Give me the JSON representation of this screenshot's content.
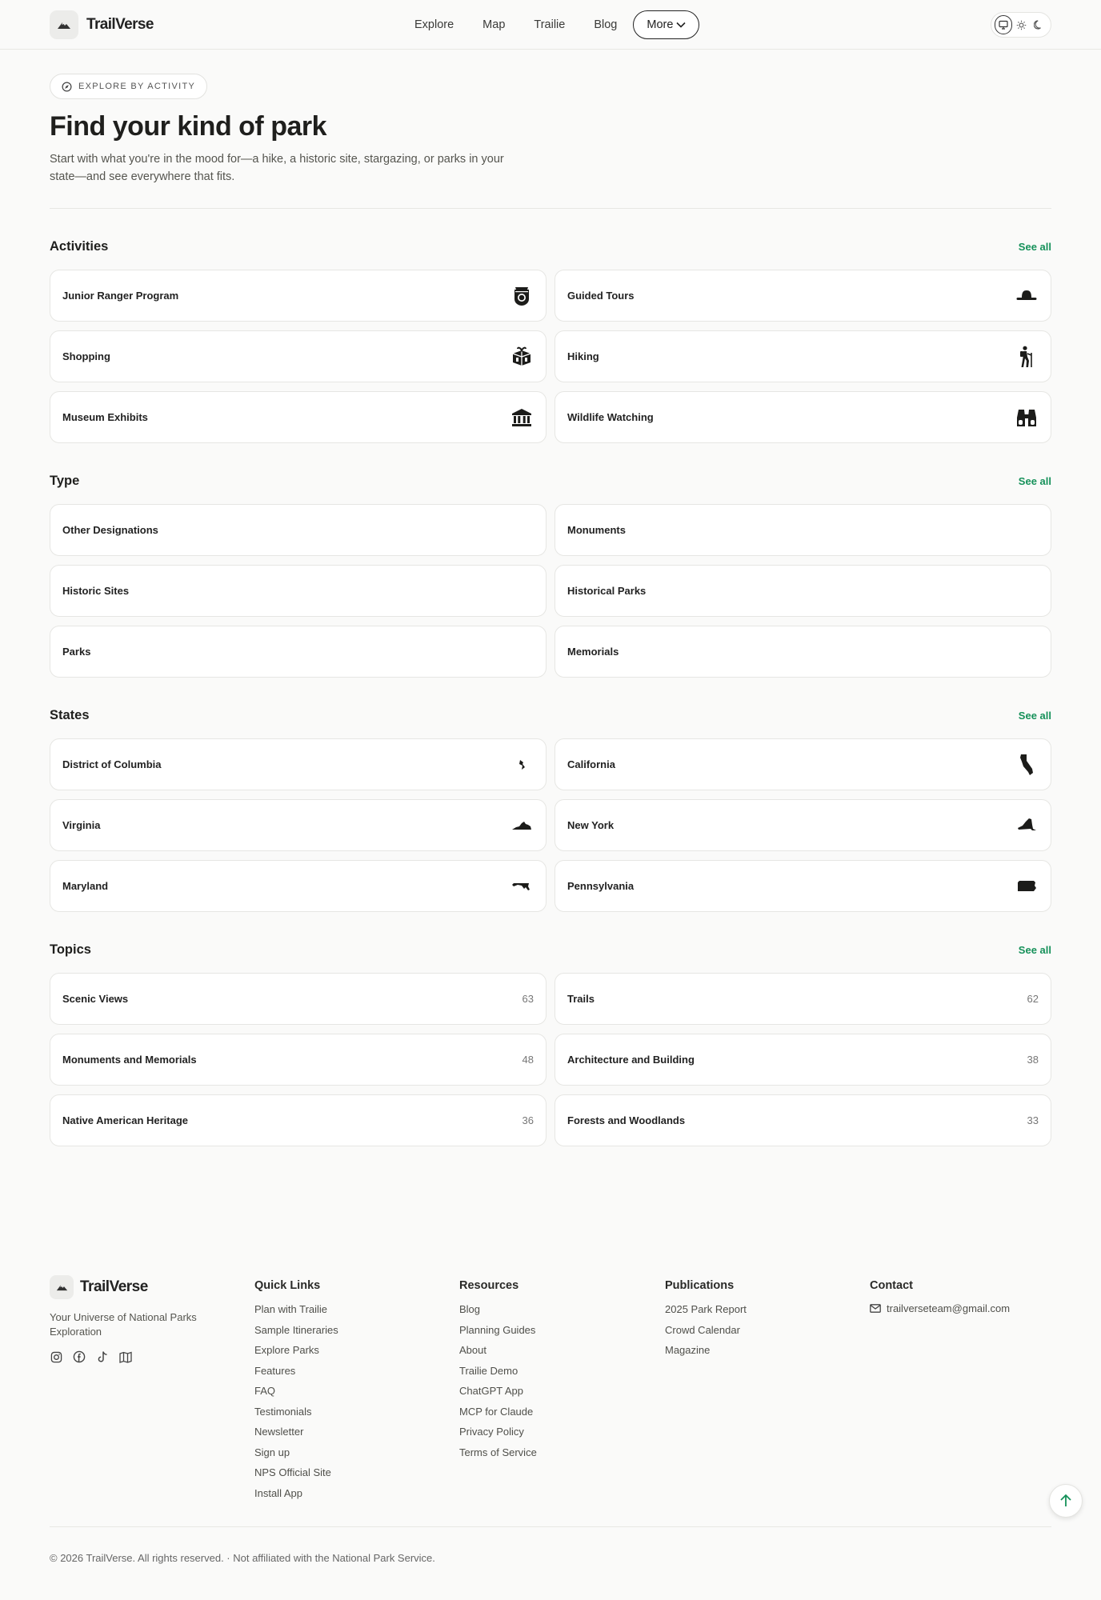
{
  "brand": {
    "name": "TrailVerse"
  },
  "nav": {
    "links": [
      "Explore",
      "Map",
      "Trailie",
      "Blog"
    ],
    "more_label": "More"
  },
  "hero": {
    "eyebrow": "EXPLORE BY ACTIVITY",
    "title": "Find your kind of park",
    "subtitle": "Start with what you're in the mood for—a hike, a historic site, stargazing, or parks in your state—and see everywhere that fits."
  },
  "sections": {
    "activities": {
      "title": "Activities",
      "see_all": "See all",
      "items": [
        {
          "label": "Junior Ranger Program",
          "icon": "badge-icon"
        },
        {
          "label": "Guided Tours",
          "icon": "ranger-hat-icon"
        },
        {
          "label": "Shopping",
          "icon": "gift-icon"
        },
        {
          "label": "Hiking",
          "icon": "hiker-icon"
        },
        {
          "label": "Museum Exhibits",
          "icon": "museum-icon"
        },
        {
          "label": "Wildlife Watching",
          "icon": "binoculars-icon"
        }
      ]
    },
    "type": {
      "title": "Type",
      "see_all": "See all",
      "items": [
        {
          "label": "Other Designations"
        },
        {
          "label": "Monuments"
        },
        {
          "label": "Historic Sites"
        },
        {
          "label": "Historical Parks"
        },
        {
          "label": "Parks"
        },
        {
          "label": "Memorials"
        }
      ]
    },
    "states": {
      "title": "States",
      "see_all": "See all",
      "items": [
        {
          "label": "District of Columbia",
          "icon": "dc-shape-icon"
        },
        {
          "label": "California",
          "icon": "california-shape-icon"
        },
        {
          "label": "Virginia",
          "icon": "virginia-shape-icon"
        },
        {
          "label": "New York",
          "icon": "new-york-shape-icon"
        },
        {
          "label": "Maryland",
          "icon": "maryland-shape-icon"
        },
        {
          "label": "Pennsylvania",
          "icon": "pennsylvania-shape-icon"
        }
      ]
    },
    "topics": {
      "title": "Topics",
      "see_all": "See all",
      "items": [
        {
          "label": "Scenic Views",
          "count": "63"
        },
        {
          "label": "Trails",
          "count": "62"
        },
        {
          "label": "Monuments and Memorials",
          "count": "48"
        },
        {
          "label": "Architecture and Building",
          "count": "38"
        },
        {
          "label": "Native American Heritage",
          "count": "36"
        },
        {
          "label": "Forests and Woodlands",
          "count": "33"
        }
      ]
    }
  },
  "footer": {
    "tagline": "Your Universe of National Parks Exploration",
    "social_icons": [
      "instagram-icon",
      "facebook-icon",
      "tiktok-icon",
      "map-icon"
    ],
    "quick_links": {
      "title": "Quick Links",
      "items": [
        "Plan with Trailie",
        "Sample Itineraries",
        "Explore Parks",
        "Features",
        "FAQ",
        "Testimonials",
        "Newsletter",
        "Sign up",
        "NPS Official Site",
        "Install App"
      ]
    },
    "resources": {
      "title": "Resources",
      "items": [
        "Blog",
        "Planning Guides",
        "About",
        "Trailie Demo",
        "ChatGPT App",
        "MCP for Claude",
        "Privacy Policy",
        "Terms of Service"
      ]
    },
    "publications": {
      "title": "Publications",
      "items": [
        "2025 Park Report",
        "Crowd Calendar",
        "Magazine"
      ]
    },
    "contact": {
      "title": "Contact",
      "email": "trailverseteam@gmail.com"
    },
    "copyright": "© 2026 TrailVerse. All rights reserved. · Not affiliated with the National Park Service."
  },
  "colors": {
    "accent": "#16915a",
    "text": "#1f1f1d",
    "muted": "#55554f",
    "border": "#e6e6e3"
  }
}
